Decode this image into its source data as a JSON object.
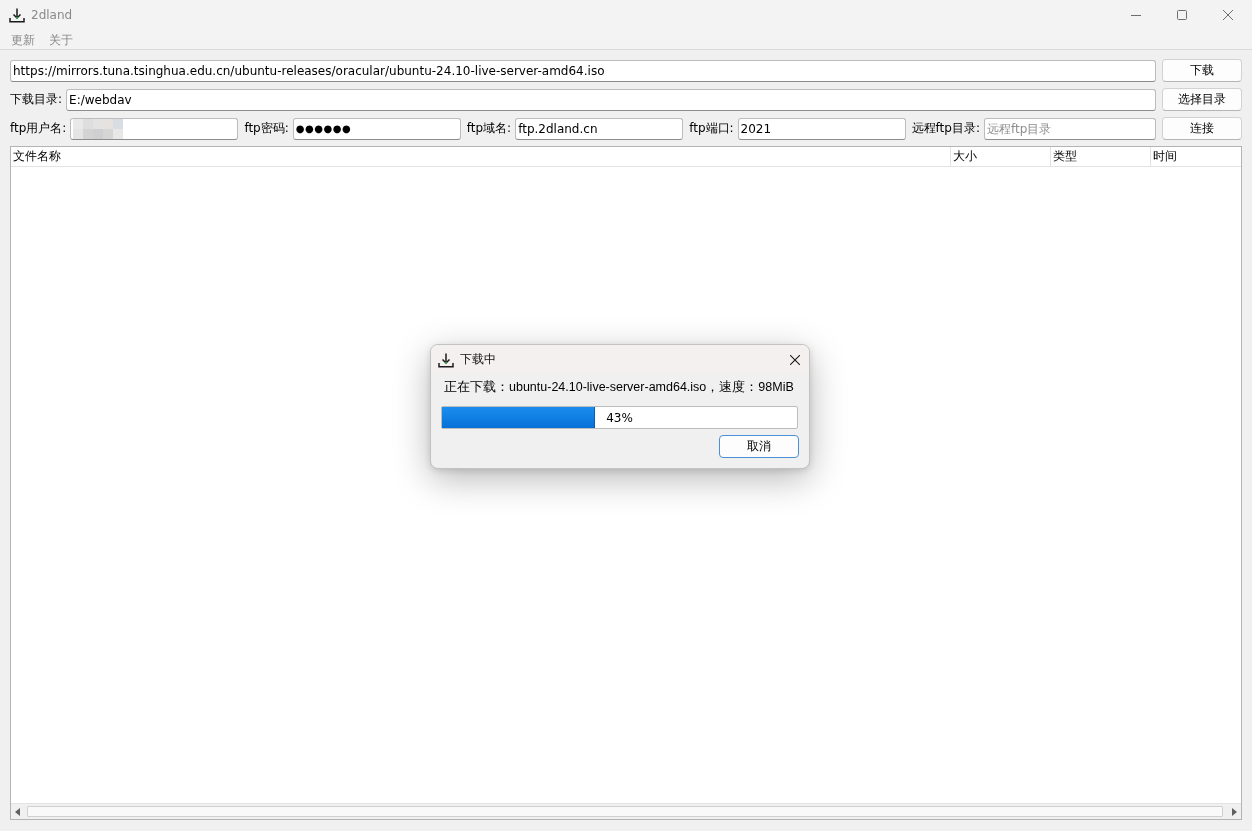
{
  "window": {
    "title": "2dland"
  },
  "menu": [
    {
      "label": "更新"
    },
    {
      "label": "关于"
    }
  ],
  "url_row": {
    "value": "https://mirrors.tuna.tsinghua.edu.cn/ubuntu-releases/oracular/ubuntu-24.10-live-server-amd64.iso",
    "button": "下载"
  },
  "directory_row": {
    "label": "下载目录:",
    "value": "E:/webdav",
    "button": "选择目录"
  },
  "ftp_row": {
    "fields": [
      {
        "label": "ftp用户名:",
        "kind": "redacted"
      },
      {
        "label": "ftp密码:",
        "kind": "password",
        "value": "●●●●●●"
      },
      {
        "label": "ftp域名:",
        "kind": "text",
        "value": "ftp.2dland.cn"
      },
      {
        "label": "ftp端口:",
        "kind": "text",
        "value": "2021"
      },
      {
        "label": "远程ftp目录:",
        "kind": "text",
        "placeholder": "远程ftp目录"
      }
    ],
    "button": "连接"
  },
  "table": {
    "columns": [
      "文件名称",
      "大小",
      "类型",
      "时间"
    ]
  },
  "dialog": {
    "title": "下载中",
    "message": "正在下载：ubuntu-24.10-live-server-amd64.iso，速度：98MiB",
    "progress": {
      "level": 0.43,
      "text": "43%"
    },
    "button": "取消"
  }
}
